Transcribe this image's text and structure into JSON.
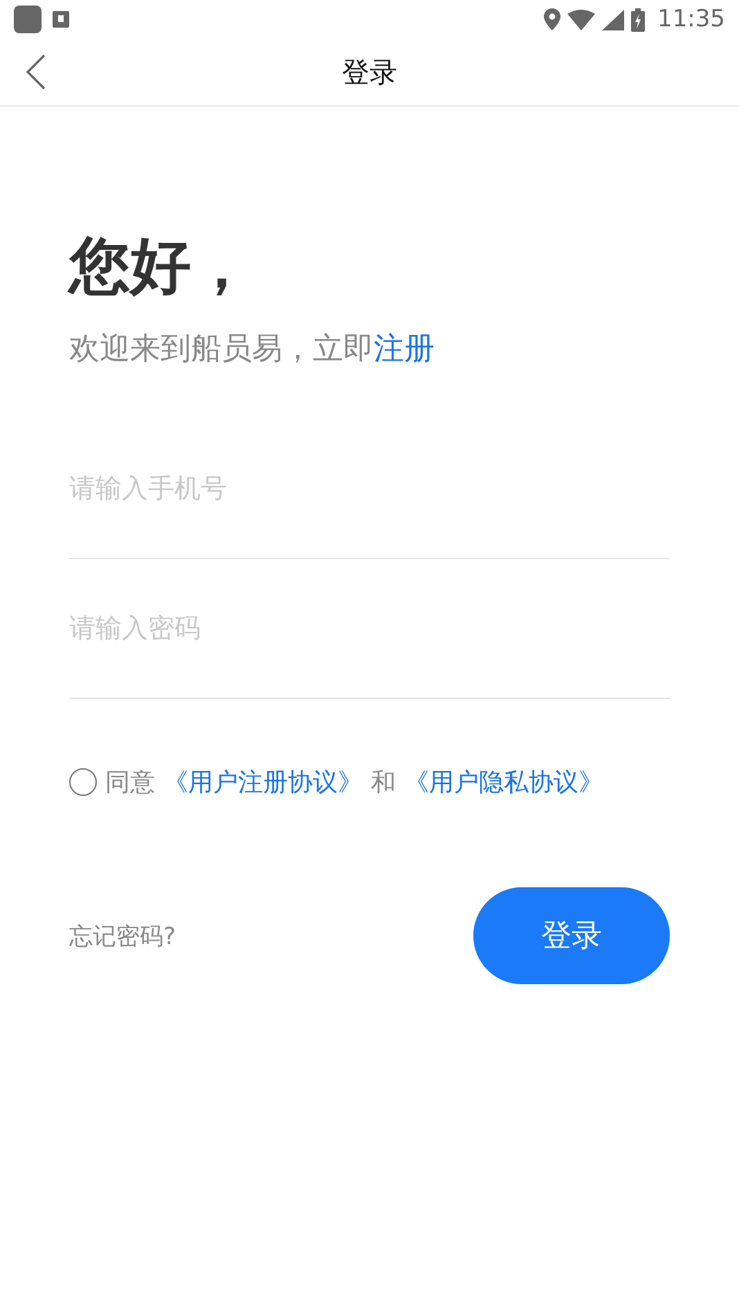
{
  "status_bar": {
    "time": "11:35"
  },
  "header": {
    "title": "登录"
  },
  "greeting": {
    "title": "您好，",
    "welcome": "欢迎来到船员易，立即",
    "register_link": "注册"
  },
  "fields": [
    {
      "placeholder": "请输入手机号"
    },
    {
      "placeholder": "请输入密码"
    }
  ],
  "agreement": {
    "checked": false,
    "prefix": "同意",
    "link_1": "《用户注册协议》",
    "joiner": "和",
    "link_2": "《用户隐私协议》"
  },
  "forgot_link": "忘记密码?",
  "login_button": "登录"
}
